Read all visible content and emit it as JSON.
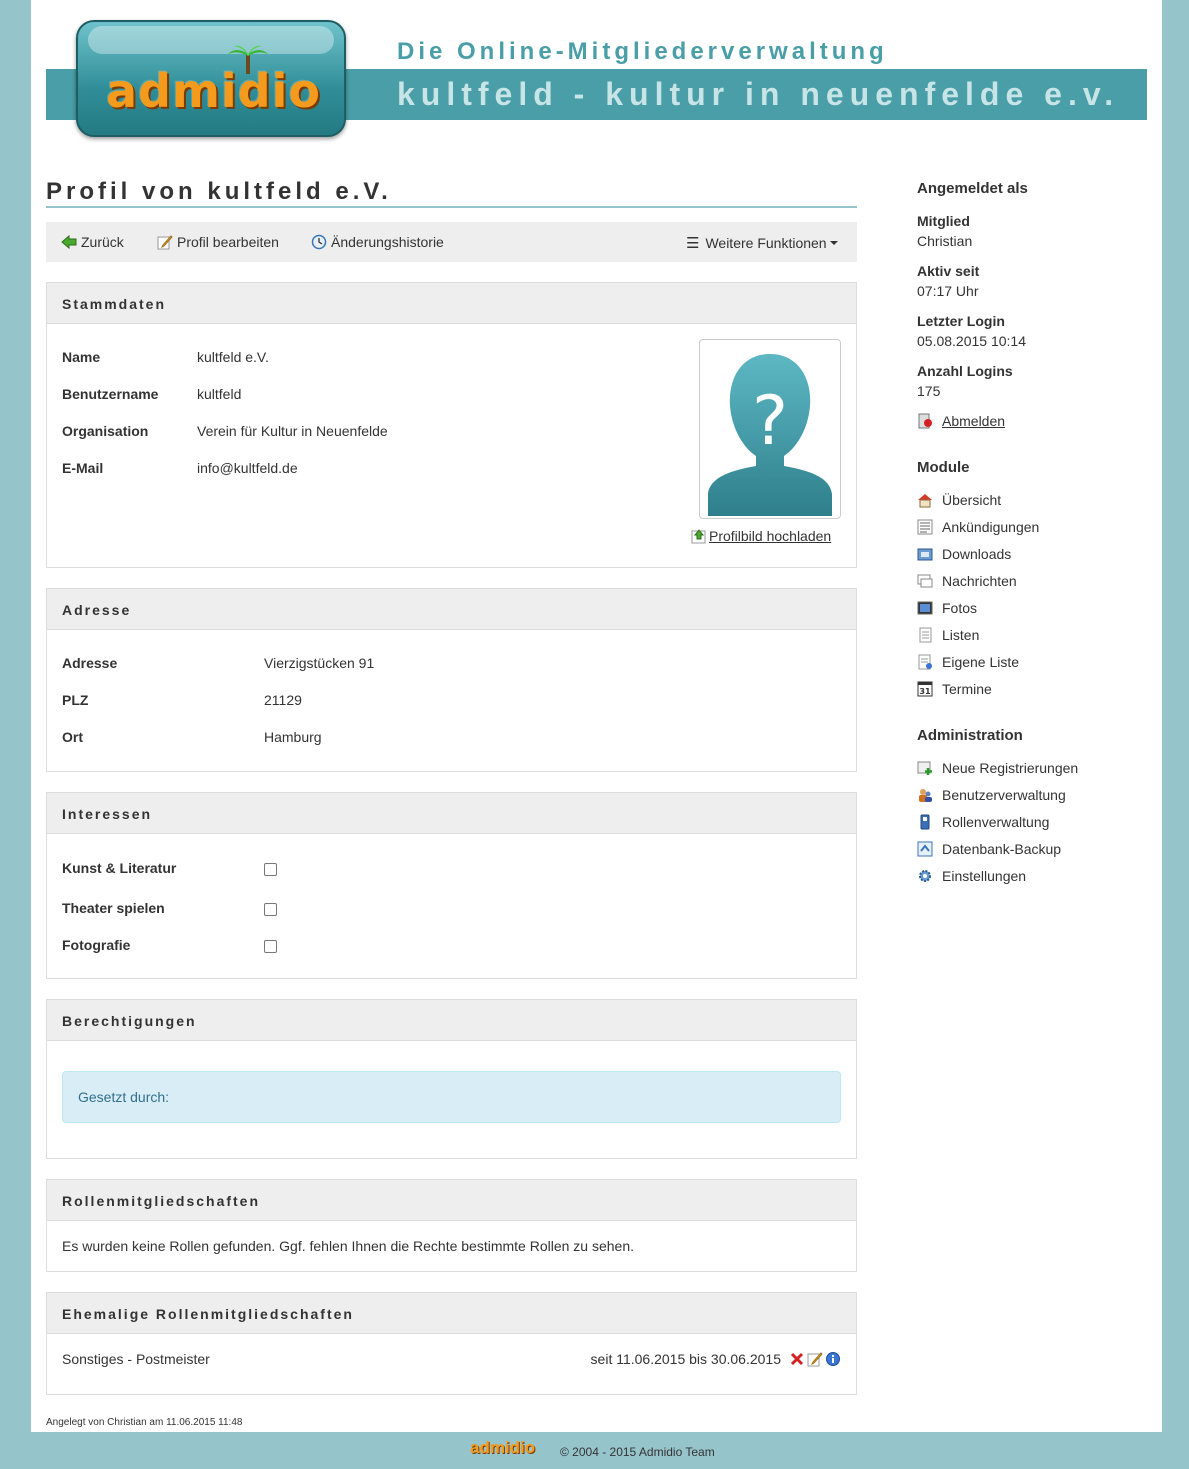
{
  "header": {
    "logo_text": "admidio",
    "site_title": "Die Online-Mitgliederverwaltung",
    "org_title": "kultfeld - kultur in neuenfelde e.v."
  },
  "page": {
    "title": "Profil von kultfeld e.V."
  },
  "toolbar": {
    "back": "Zurück",
    "edit": "Profil bearbeiten",
    "history": "Änderungshistorie",
    "more": "Weitere Funktionen"
  },
  "stammdaten": {
    "heading": "Stammdaten",
    "rows": [
      {
        "label": "Name",
        "value": "kultfeld e.V."
      },
      {
        "label": "Benutzername",
        "value": "kultfeld"
      },
      {
        "label": "Organisation",
        "value": "Verein für Kultur in Neuenfelde"
      },
      {
        "label": "E-Mail",
        "value": "info@kultfeld.de"
      }
    ],
    "upload_photo": " Profilbild hochladen"
  },
  "adresse": {
    "heading": "Adresse",
    "rows": [
      {
        "label": "Adresse",
        "value": "Vierzigstücken 91"
      },
      {
        "label": "PLZ",
        "value": "21129"
      },
      {
        "label": "Ort",
        "value": "Hamburg"
      }
    ]
  },
  "interessen": {
    "heading": "Interessen",
    "rows": [
      {
        "label": "Kunst & Literatur"
      },
      {
        "label": "Theater spielen"
      },
      {
        "label": "Fotografie"
      }
    ]
  },
  "berechtigungen": {
    "heading": "Berechtigungen",
    "info": "Gesetzt durch:"
  },
  "rollen": {
    "heading": "Rollenmitgliedschaften",
    "empty": "Es wurden keine Rollen gefunden. Ggf. fehlen Ihnen die Rechte bestimmte Rollen zu sehen."
  },
  "ehemalige": {
    "heading": "Ehemalige Rollenmitgliedschaften",
    "category": "Sonstiges - ",
    "role": "Postmeister",
    "period": "seit 11.06.2015 bis 30.06.2015"
  },
  "created": {
    "prefix": "Angelegt von ",
    "user": "Christian",
    "suffix": " am 11.06.2015 11:48"
  },
  "sidebar": {
    "login_heading": "Angemeldet als",
    "member_label": "Mitglied",
    "member_name": "Christian",
    "active_label": "Aktiv seit",
    "active_value": "07:17 Uhr",
    "last_login_label": "Letzter Login",
    "last_login_value": "05.08.2015 10:14",
    "count_label": "Anzahl Logins",
    "count_value": "175",
    "logout": "Abmelden",
    "modules_heading": "Module",
    "modules": [
      "Übersicht",
      "Ankündigungen",
      "Downloads",
      "Nachrichten",
      "Fotos",
      "Listen",
      "Eigene Liste",
      "Termine"
    ],
    "admin_heading": "Administration",
    "admin": [
      "Neue Registrierungen",
      "Benutzerverwaltung",
      "Rollenverwaltung",
      "Datenbank-Backup",
      "Einstellungen"
    ]
  },
  "footer": {
    "logo_text": "admidio",
    "copyright": "© 2004 - 2015  Admidio Team"
  }
}
